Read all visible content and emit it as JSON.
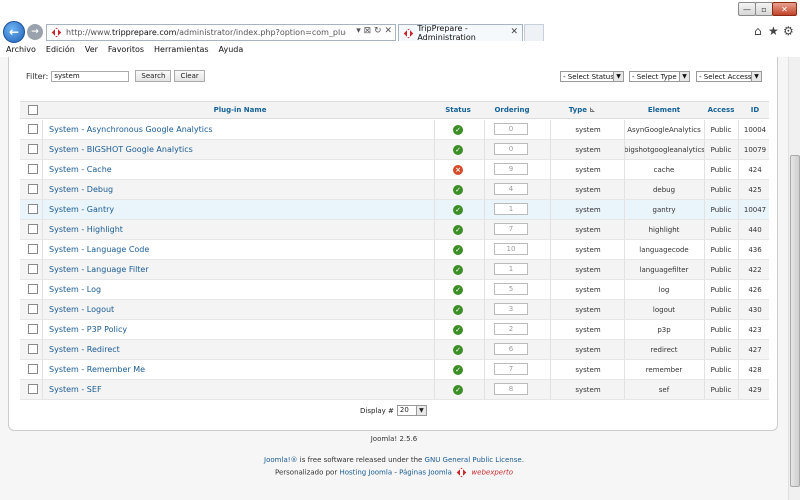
{
  "browser": {
    "url_scheme": "http://www.",
    "url_domain": "tripprepare.com",
    "url_path": "/administrator/index.php?option=com_plugins&view=plugi",
    "tab_title": "TripPrepare - Administration",
    "addr_icons": "▾ ⊠ ↻ ✕",
    "window": {
      "min": "—",
      "max": "▫",
      "close": "✕"
    },
    "menu": [
      "Archivo",
      "Edición",
      "Ver",
      "Favoritos",
      "Herramientas",
      "Ayuda"
    ]
  },
  "filter": {
    "label": "Filter:",
    "value": "system",
    "search_label": "Search",
    "clear_label": "Clear"
  },
  "selects": {
    "status": "- Select Status -",
    "type": "- Select Type -",
    "access": "- Select Access -"
  },
  "table": {
    "headers": {
      "name": "Plug-in Name",
      "status": "Status",
      "ordering": "Ordering",
      "type": "Type",
      "element": "Element",
      "access": "Access",
      "id": "ID"
    },
    "rows": [
      {
        "name": "System - Asynchronous Google Analytics",
        "enabled": true,
        "ordering": "0",
        "type": "system",
        "element": "AsynGoogleAnalytics",
        "access": "Public",
        "id": "10004"
      },
      {
        "name": "System - BIGSHOT Google Analytics",
        "enabled": true,
        "ordering": "0",
        "type": "system",
        "element": "bigshotgoogleanalytics",
        "access": "Public",
        "id": "10079"
      },
      {
        "name": "System - Cache",
        "enabled": false,
        "ordering": "9",
        "type": "system",
        "element": "cache",
        "access": "Public",
        "id": "424"
      },
      {
        "name": "System - Debug",
        "enabled": true,
        "ordering": "4",
        "type": "system",
        "element": "debug",
        "access": "Public",
        "id": "425"
      },
      {
        "name": "System - Gantry",
        "enabled": true,
        "ordering": "1",
        "type": "system",
        "element": "gantry",
        "access": "Public",
        "id": "10047"
      },
      {
        "name": "System - Highlight",
        "enabled": true,
        "ordering": "7",
        "type": "system",
        "element": "highlight",
        "access": "Public",
        "id": "440"
      },
      {
        "name": "System - Language Code",
        "enabled": true,
        "ordering": "10",
        "type": "system",
        "element": "languagecode",
        "access": "Public",
        "id": "436"
      },
      {
        "name": "System - Language Filter",
        "enabled": true,
        "ordering": "1",
        "type": "system",
        "element": "languagefilter",
        "access": "Public",
        "id": "422"
      },
      {
        "name": "System - Log",
        "enabled": true,
        "ordering": "5",
        "type": "system",
        "element": "log",
        "access": "Public",
        "id": "426"
      },
      {
        "name": "System - Logout",
        "enabled": true,
        "ordering": "3",
        "type": "system",
        "element": "logout",
        "access": "Public",
        "id": "430"
      },
      {
        "name": "System - P3P Policy",
        "enabled": true,
        "ordering": "2",
        "type": "system",
        "element": "p3p",
        "access": "Public",
        "id": "423"
      },
      {
        "name": "System - Redirect",
        "enabled": true,
        "ordering": "6",
        "type": "system",
        "element": "redirect",
        "access": "Public",
        "id": "427"
      },
      {
        "name": "System - Remember Me",
        "enabled": true,
        "ordering": "7",
        "type": "system",
        "element": "remember",
        "access": "Public",
        "id": "428"
      },
      {
        "name": "System - SEF",
        "enabled": true,
        "ordering": "8",
        "type": "system",
        "element": "sef",
        "access": "Public",
        "id": "429"
      }
    ]
  },
  "pagination": {
    "display_label": "Display #",
    "display_value": "20"
  },
  "footer": {
    "version": "Joomla! 2.5.6",
    "joomla_link": "Joomla!®",
    "free_text": " is free software released under the ",
    "license_link": "GNU General Public License.",
    "custom_prefix": "Personalizado por ",
    "hosting_link": "Hosting Joomla",
    "separator": " - ",
    "pages_link": "Páginas Joomla",
    "brand": "webexperto"
  },
  "colors": {
    "link": "#1a5b92",
    "header_text": "#146295",
    "enabled": "#3c8f26",
    "disabled": "#d74b29"
  }
}
